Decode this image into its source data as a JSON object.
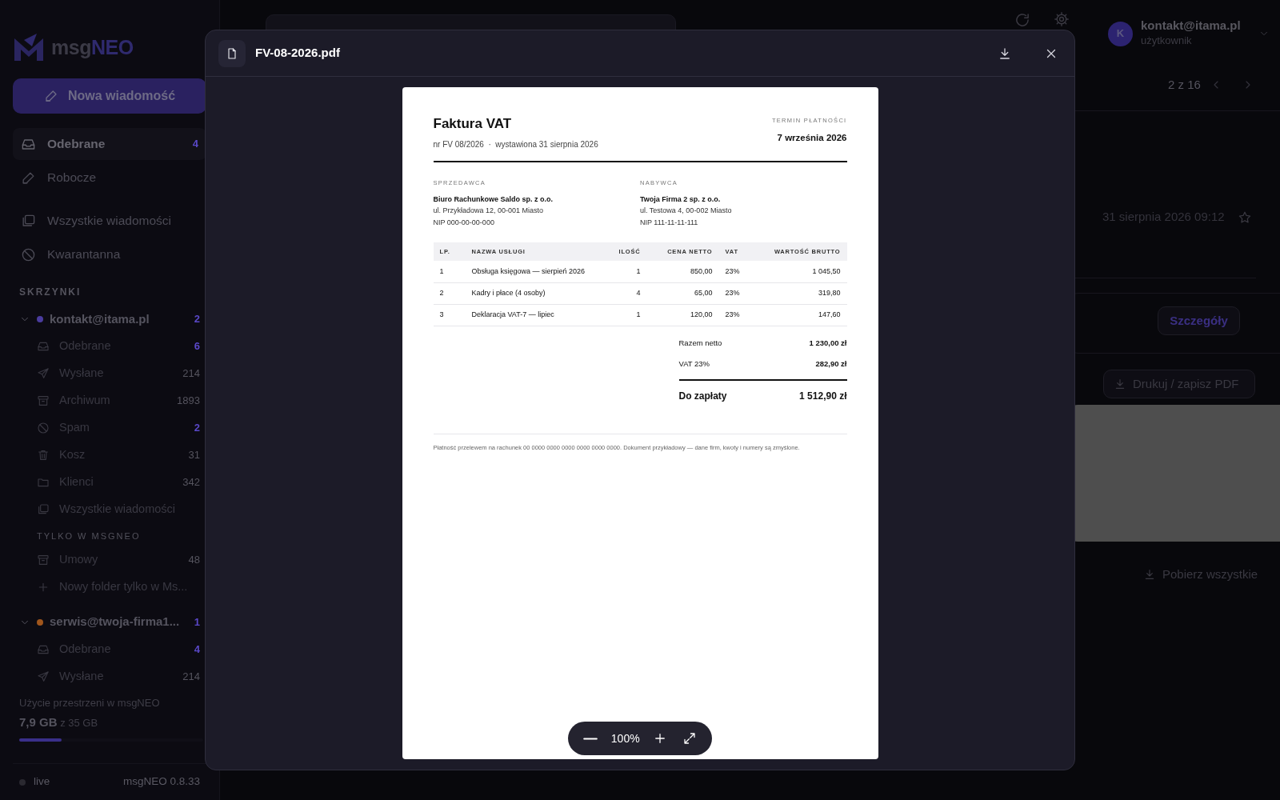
{
  "sidebar": {
    "logo": {
      "first": "msg",
      "second": "NEO"
    },
    "compose_button": "Nowa wiadomość",
    "nav_primary": [
      {
        "label": "Odebrane",
        "count": "4",
        "kind": "inbox",
        "selected": true
      },
      {
        "label": "Robocze",
        "kind": "draft",
        "selected": false
      }
    ],
    "nav_secondary": [
      {
        "label": "Wszystkie wiadomości",
        "kind": "all",
        "selected": false
      },
      {
        "label": "Kwarantanna",
        "kind": "blocked",
        "selected": false
      }
    ],
    "section_title": "SKRZYNKI",
    "accounts": [
      {
        "address": "kontakt@itama.pl",
        "count": "2",
        "color": "#4a3c9e",
        "expanded": true,
        "folders": [
          {
            "label": "Odebrane",
            "count": "6",
            "kind": "inbox",
            "unread": true
          },
          {
            "label": "Wysłane",
            "count": "214",
            "kind": "sent",
            "unread": false
          },
          {
            "label": "Archiwum",
            "count": "1893",
            "kind": "archive",
            "unread": false
          },
          {
            "label": "Spam",
            "count": "2",
            "kind": "blocked",
            "unread": true
          },
          {
            "label": "Kosz",
            "count": "31",
            "kind": "trash",
            "unread": false
          },
          {
            "label": "Klienci",
            "count": "342",
            "kind": "folder",
            "unread": false
          },
          {
            "label": "Wszystkie wiadomości",
            "kind": "all"
          }
        ],
        "local_title": "TYLKO W MSGNEO",
        "local_folders": [
          {
            "label": "Umowy",
            "count": "48",
            "kind": "archive",
            "unread": false
          }
        ],
        "add_folder": "Nowy folder tylko w Ms..."
      },
      {
        "address": "serwis@twoja-firma1...",
        "count": "1",
        "color": "#a0561c",
        "expanded": true,
        "folders": [
          {
            "label": "Odebrane",
            "count": "4",
            "kind": "inbox",
            "unread": true
          },
          {
            "label": "Wysłane",
            "count": "214",
            "kind": "sent",
            "unread": false
          }
        ]
      }
    ],
    "storage": {
      "title": "Użycie przestrzeni w msgNEO",
      "used": "7,9 GB",
      "total": "z 35 GB",
      "level": 0.23
    },
    "footer": {
      "status": "live",
      "version": "msgNEO 0.8.33"
    }
  },
  "header": {
    "user": {
      "initial": "K",
      "email": "kontakt@itama.pl",
      "role": "użytkownik"
    }
  },
  "message": {
    "pager": "2 z 16",
    "date": "31 sierpnia 2026 09:12",
    "starred": false,
    "details_button": "Szczegóły",
    "print_button": "Drukuj / zapisz PDF",
    "download_all": "Pobierz wszystkie"
  },
  "viewer": {
    "filename": "FV-08-2026.pdf",
    "zoom": "100%",
    "document": {
      "title": "Faktura VAT",
      "meta": "nr FV 08/2026  ·  wystawiona 31 sierpnia 2026",
      "due_label": "TERMIN PŁATNOŚCI",
      "due_date": "7 września 2026",
      "parties": [
        {
          "label": "SPRZEDAWCA",
          "name": "Biuro Rachunkowe Saldo sp. z o.o.",
          "lines": [
            "ul. Przykładowa 12, 00-001 Miasto",
            "NIP 000-00-00-000"
          ]
        },
        {
          "label": "NABYWCA",
          "name": "Twoja Firma 2 sp. z o.o.",
          "lines": [
            "ul. Testowa 4, 00-002 Miasto",
            "NIP 111-11-11-111"
          ]
        }
      ],
      "columns": [
        "LP.",
        "NAZWA USŁUGI",
        "ILOŚĆ",
        "CENA NETTO",
        "VAT",
        "WARTOŚĆ BRUTTO"
      ],
      "rows": [
        [
          "1",
          "Obsługa księgowa — sierpień 2026",
          "1",
          "850,00",
          "23%",
          "1 045,50"
        ],
        [
          "2",
          "Kadry i płace (4 osoby)",
          "4",
          "65,00",
          "23%",
          "319,80"
        ],
        [
          "3",
          "Deklaracja VAT-7 — lipiec",
          "1",
          "120,00",
          "23%",
          "147,60"
        ]
      ],
      "totals": [
        {
          "label": "Razem netto",
          "value": "1 230,00 zł",
          "kind": "line"
        },
        {
          "label": "VAT 23%",
          "value": "282,90 zł",
          "kind": "line"
        },
        {
          "label": "Do zapłaty",
          "value": "1 512,90 zł",
          "kind": "grand"
        }
      ],
      "footnote": "Płatność przelewem na rachunek 00 0000 0000 0000 0000 0000 0000. Dokument przykładowy — dane firm, kwoty i numery są zmyślone."
    }
  }
}
